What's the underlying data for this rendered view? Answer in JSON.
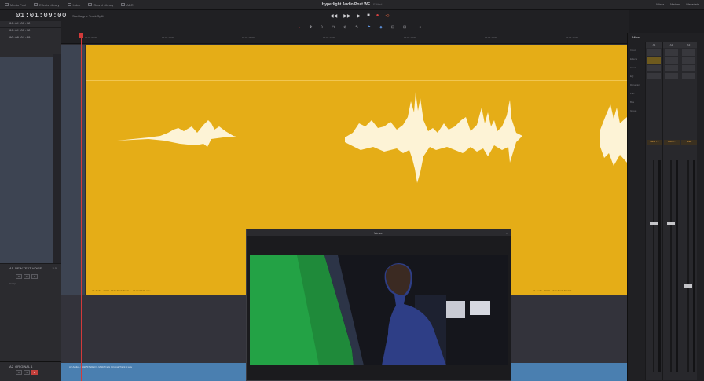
{
  "menu": {
    "items": [
      {
        "label": "Media Pool"
      },
      {
        "label": "Effects Library"
      },
      {
        "label": "Index"
      },
      {
        "label": "Sound Library"
      },
      {
        "label": "ADR"
      }
    ],
    "project_title": "Hyperlight Audio Post WF",
    "project_status": "Edited",
    "right_items": [
      {
        "label": "Mixer"
      },
      {
        "label": "Meters"
      },
      {
        "label": "Metadata"
      }
    ]
  },
  "toolbar": {
    "timecode": "01:01:09:00",
    "timeline_name": "Sachlaigne Track Split"
  },
  "timecodes": [
    "01:01:09:16",
    "01:01:09:16",
    "00:00:01:00"
  ],
  "ruler": {
    "ticks": [
      "01:01:09:00",
      "01:01:10:00",
      "01:01:11:00",
      "01:01:12:00",
      "01:01:13:00",
      "01:01:14:00",
      "01:01:15:00"
    ]
  },
  "tracks": {
    "a1": {
      "index": "A1",
      "name": "NEW TEXT VOICE",
      "level": "2.0",
      "clips_label": "0 Clips"
    },
    "a2": {
      "index": "A2",
      "name": "ORIGINAL 1",
      "level": "2.0"
    }
  },
  "clips": {
    "a1_label": "A1 Audio - RAW - Multi-Track Track 1 - 01:01:07:06.wav",
    "a1b_label": "A1 Audio - RAW - Multi-Track Track 1",
    "a2_label": "A2 Audio - RAW/STEREO - Multi-Track Original Track 1.wav"
  },
  "viewer": {
    "title": "Viewer",
    "close": "×"
  },
  "mixer": {
    "title": "Mixer",
    "row_labels": [
      "Input",
      "Effects",
      "Insert",
      "EQ",
      "Dynamics",
      "Pan",
      "Bus",
      "Group"
    ],
    "channels": [
      {
        "name": "A1",
        "label": "NEW T..."
      },
      {
        "name": "A2",
        "label": "ORIG..."
      },
      {
        "name": "A3",
        "label": "M&E"
      },
      {
        "name": "A4",
        "label": "FX"
      }
    ]
  },
  "colors": {
    "clip_audio": "#e5ad17",
    "clip_audio_blue": "#4a7fb0",
    "playhead": "#d23a3a",
    "waveform": "#fdf3d6"
  },
  "icons": {
    "play": "play-icon",
    "stop": "stop-icon",
    "record": "record-icon",
    "loop": "loop-icon"
  }
}
